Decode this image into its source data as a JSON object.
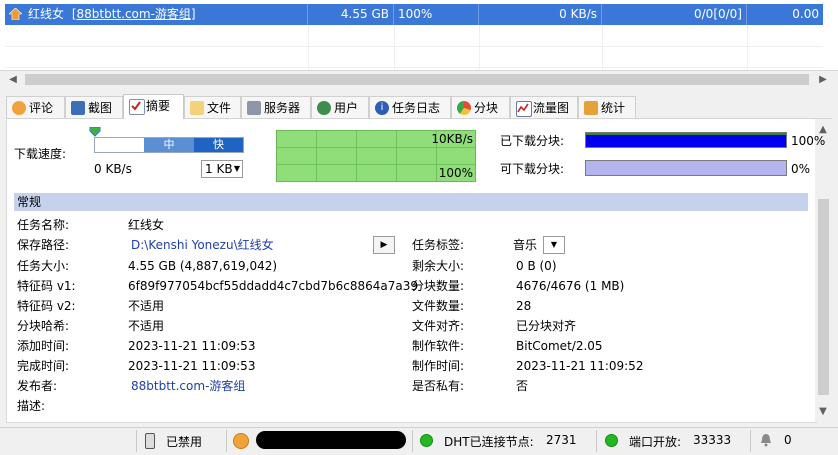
{
  "torrent_list": {
    "row": {
      "name": "红线女",
      "tag": "[88btbtt.com-游客组]",
      "size": "4.55 GB",
      "progress": "100%",
      "speed": "0 KB/s",
      "peers": "0/0[0/0]",
      "ratio": "0.00"
    }
  },
  "tabs": [
    {
      "label": "评论",
      "icon": "comment-icon"
    },
    {
      "label": "截图",
      "icon": "screenshot-icon"
    },
    {
      "label": "摘要",
      "icon": "summary-check-icon"
    },
    {
      "label": "文件",
      "icon": "file-icon"
    },
    {
      "label": "服务器",
      "icon": "server-icon"
    },
    {
      "label": "用户",
      "icon": "users-icon"
    },
    {
      "label": "任务日志",
      "icon": "info-icon"
    },
    {
      "label": "分块",
      "icon": "pie-icon"
    },
    {
      "label": "流量图",
      "icon": "chart-icon"
    },
    {
      "label": "统计",
      "icon": "stats-icon"
    }
  ],
  "active_tab": "摘要",
  "speed": {
    "label": "下载速度:",
    "slider_mid": "中",
    "slider_fast": "快",
    "current": "0 KB/s",
    "limit": "1 KB",
    "graph_top": "10KB/s",
    "graph_bottom": "100%"
  },
  "pieces": {
    "downloaded_label": "已下载分块:",
    "downloaded_pct": "100%",
    "downloaded_fraction": 1.0,
    "available_label": "可下载分块:",
    "available_pct": "0%"
  },
  "section_title": "常规",
  "general_left": [
    {
      "label": "任务名称:",
      "value": "红线女"
    },
    {
      "label": "保存路径:",
      "value": "D:\\Kenshi Yonezu\\红线女"
    },
    {
      "label": "任务大小:",
      "value": "4.55 GB (4,887,619,042)"
    },
    {
      "label": "特征码 v1:",
      "value": "6f89f977054bcf55ddadd4c7cbd7b6c8864a7a39"
    },
    {
      "label": "特征码 v2:",
      "value": "不适用"
    },
    {
      "label": "分块哈希:",
      "value": "不适用"
    },
    {
      "label": "添加时间:",
      "value": "2023-11-21 11:09:53"
    },
    {
      "label": "完成时间:",
      "value": "2023-11-21 11:09:53"
    },
    {
      "label": "发布者:",
      "value": "88btbtt.com-游客组"
    },
    {
      "label": "描述:",
      "value": ""
    }
  ],
  "general_right": [
    {
      "label": "任务标签:",
      "value": "音乐"
    },
    {
      "label": "剩余大小:",
      "value": "0 B (0)"
    },
    {
      "label": "分块数量:",
      "value": "4676/4676 (1 MB)"
    },
    {
      "label": "文件数量:",
      "value": "28"
    },
    {
      "label": "文件对齐:",
      "value": "已分块对齐"
    },
    {
      "label": "制作软件:",
      "value": "BitComet/2.05"
    },
    {
      "label": "制作时间:",
      "value": "2023-11-21 11:09:52"
    },
    {
      "label": "是否私有:",
      "value": "否"
    }
  ],
  "status_bar": {
    "disabled": "已禁用",
    "dht_label": "DHT已连接节点:",
    "dht_count": "2731",
    "port_label": "端口开放:",
    "port": "33333",
    "alerts": "0"
  }
}
